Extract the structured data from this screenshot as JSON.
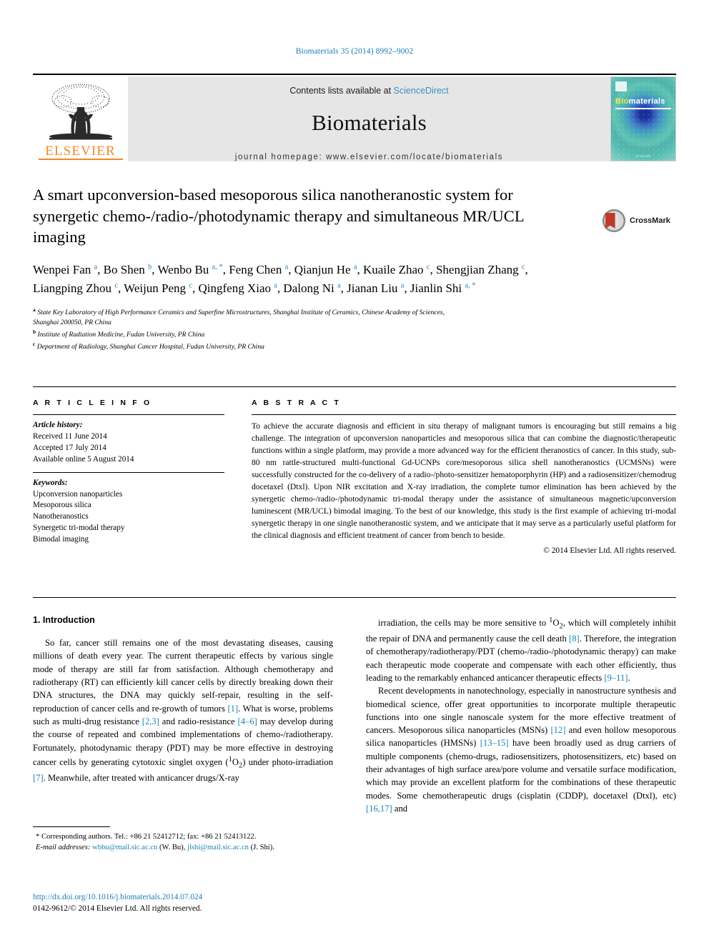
{
  "running_head": "Biomaterials 35 (2014) 8992–9002",
  "masthead": {
    "contents_prefix": "Contents lists available at ",
    "sciencedirect": "ScienceDirect",
    "journal_name": "Biomaterials",
    "homepage": "journal homepage: www.elsevier.com/locate/biomaterials",
    "publisher": "ELSEVIER",
    "cover_title_bio": "Bio",
    "cover_title_rest": "materials",
    "cover_footer": "ELSEVIER"
  },
  "article": {
    "title": "A smart upconversion-based mesoporous silica nanotheranostic system for synergetic chemo-/radio-/photodynamic therapy and simultaneous MR/UCL imaging",
    "crossmark_label": "CrossMark",
    "authors_html": "Wenpei Fan <sup>a</sup>, Bo Shen <sup>b</sup>, Wenbo Bu <sup>a, *</sup>, Feng Chen <sup>a</sup>, Qianjun He <sup>a</sup>, Kuaile Zhao <sup>c</sup>, Shengjian Zhang <sup>c</sup>, Liangping Zhou <sup>c</sup>, Weijun Peng <sup>c</sup>, Qingfeng Xiao <sup>a</sup>, Dalong Ni <sup>a</sup>, Jianan Liu <sup>a</sup>, Jianlin Shi <sup>a, *</sup>",
    "affiliations": [
      {
        "mark": "a",
        "text": "State Key Laboratory of High Performance Ceramics and Superfine Microstructures, Shanghai Institute of Ceramics, Chinese Academy of Sciences,"
      },
      {
        "mark": "",
        "text": "Shanghai 200050, PR China"
      },
      {
        "mark": "b",
        "text": "Institute of Radiation Medicine, Fudan University, PR China"
      },
      {
        "mark": "c",
        "text": "Department of Radiology, Shanghai Cancer Hospital, Fudan University, PR China"
      }
    ]
  },
  "article_info": {
    "heading": "A R T I C L E   I N F O",
    "history_label": "Article history:",
    "history": [
      "Received 11 June 2014",
      "Accepted 17 July 2014",
      "Available online 5 August 2014"
    ],
    "keywords_label": "Keywords:",
    "keywords": [
      "Upconversion nanoparticles",
      "Mesoporous silica",
      "Nanotheranostics",
      "Synergetic tri-modal therapy",
      "Bimodal imaging"
    ]
  },
  "abstract": {
    "heading": "A B S T R A C T",
    "text": "To achieve the accurate diagnosis and efficient in situ therapy of malignant tumors is encouraging but still remains a big challenge. The integration of upconversion nanoparticles and mesoporous silica that can combine the diagnostic/therapeutic functions within a single platform, may provide a more advanced way for the efficient theranostics of cancer. In this study, sub-80 nm rattle-structured multi-functional Gd-UCNPs core/mesoporous silica shell nanotheranostics (UCMSNs) were successfully constructed for the co-delivery of a radio-/photo-sensitizer hematoporphyrin (HP) and a radiosensitizer/chemodrug docetaxel (Dtxl). Upon NIR excitation and X-ray irradiation, the complete tumor elimination has been achieved by the synergetic chemo-/radio-/photodynamic tri-modal therapy under the assistance of simultaneous magnetic/upconversion luminescent (MR/UCL) bimodal imaging. To the best of our knowledge, this study is the first example of achieving tri-modal synergetic therapy in one single nanotheranostic system, and we anticipate that it may serve as a particularly useful platform for the clinical diagnosis and efficient treatment of cancer from bench to beside.",
    "copyright": "© 2014 Elsevier Ltd. All rights reserved."
  },
  "introduction": {
    "heading": "1. Introduction",
    "left_paragraphs_html": [
      "So far, cancer still remains one of the most devastating diseases, causing millions of death every year. The current therapeutic effects by various single mode of therapy are still far from satisfaction. Although chemotherapy and radiotherapy (RT) can efficiently kill cancer cells by directly breaking down their DNA structures, the DNA may quickly self-repair, resulting in the self-reproduction of cancer cells and re-growth of tumors <span class=\"ref\">[1]</span>. What is worse, problems such as multi-drug resistance <span class=\"ref\">[2,3]</span> and radio-resistance <span class=\"ref\">[4–6]</span> may develop during the course of repeated and combined implementations of chemo-/radiotherapy. Fortunately, photodynamic therapy (PDT) may be more effective in destroying cancer cells by generating cytotoxic singlet oxygen (<sup>1</sup>O<sub>2</sub>) under photo-irradiation <span class=\"ref\">[7]</span>. Meanwhile, after treated with anticancer drugs/X-ray"
    ],
    "right_paragraphs_html": [
      "irradiation, the cells may be more sensitive to <sup>1</sup>O<sub>2</sub>, which will completely inhibit the repair of DNA and permanently cause the cell death <span class=\"ref\">[8]</span>. Therefore, the integration of chemotherapy/radiotherapy/PDT (chemo-/radio-/photodynamic therapy) can make each therapeutic mode cooperate and compensate with each other efficiently, thus leading to the remarkably enhanced anticancer therapeutic effects <span class=\"ref\">[9–11]</span>.",
      "Recent developments in nanotechnology, especially in nanostructure synthesis and biomedical science, offer great opportunities to incorporate multiple therapeutic functions into one single nanoscale system for the more effective treatment of cancers. Mesoporous silica nanoparticles (MSNs) <span class=\"ref\">[12]</span> and even hollow mesoporous silica nanoparticles (HMSNs) <span class=\"ref\">[13–15]</span> have been broadly used as drug carriers of multiple components (chemo-drugs, radiosensitizers, photosensitizers, etc) based on their advantages of high surface area/pore volume and versatile surface modification, which may provide an excellent platform for the combinations of these therapeutic modes. Some chemotherapeutic drugs (cisplatin (CDDP), docetaxel (Dtxl), etc) <span class=\"ref\">[16,17]</span> and"
    ]
  },
  "footnote": {
    "corresponding_html": "<span>*</span> Corresponding authors. Tel.: +86 21 52412712; fax: +86 21 52413122.",
    "email_label": "E-mail addresses:",
    "email1": "wbbu@mail.sic.ac.cn",
    "email1_owner": "(W. Bu),",
    "email2": "jlshi@mail.sic.ac.cn",
    "email2_owner": "(J. Shi)."
  },
  "footer": {
    "doi": "http://dx.doi.org/10.1016/j.biomaterials.2014.07.024",
    "issn_line": "0142-9612/© 2014 Elsevier Ltd. All rights reserved."
  },
  "colors": {
    "link_blue": "#1a7fb5",
    "elsevier_orange": "#f08a24",
    "sciencedirect_blue": "#3a8fc7"
  }
}
